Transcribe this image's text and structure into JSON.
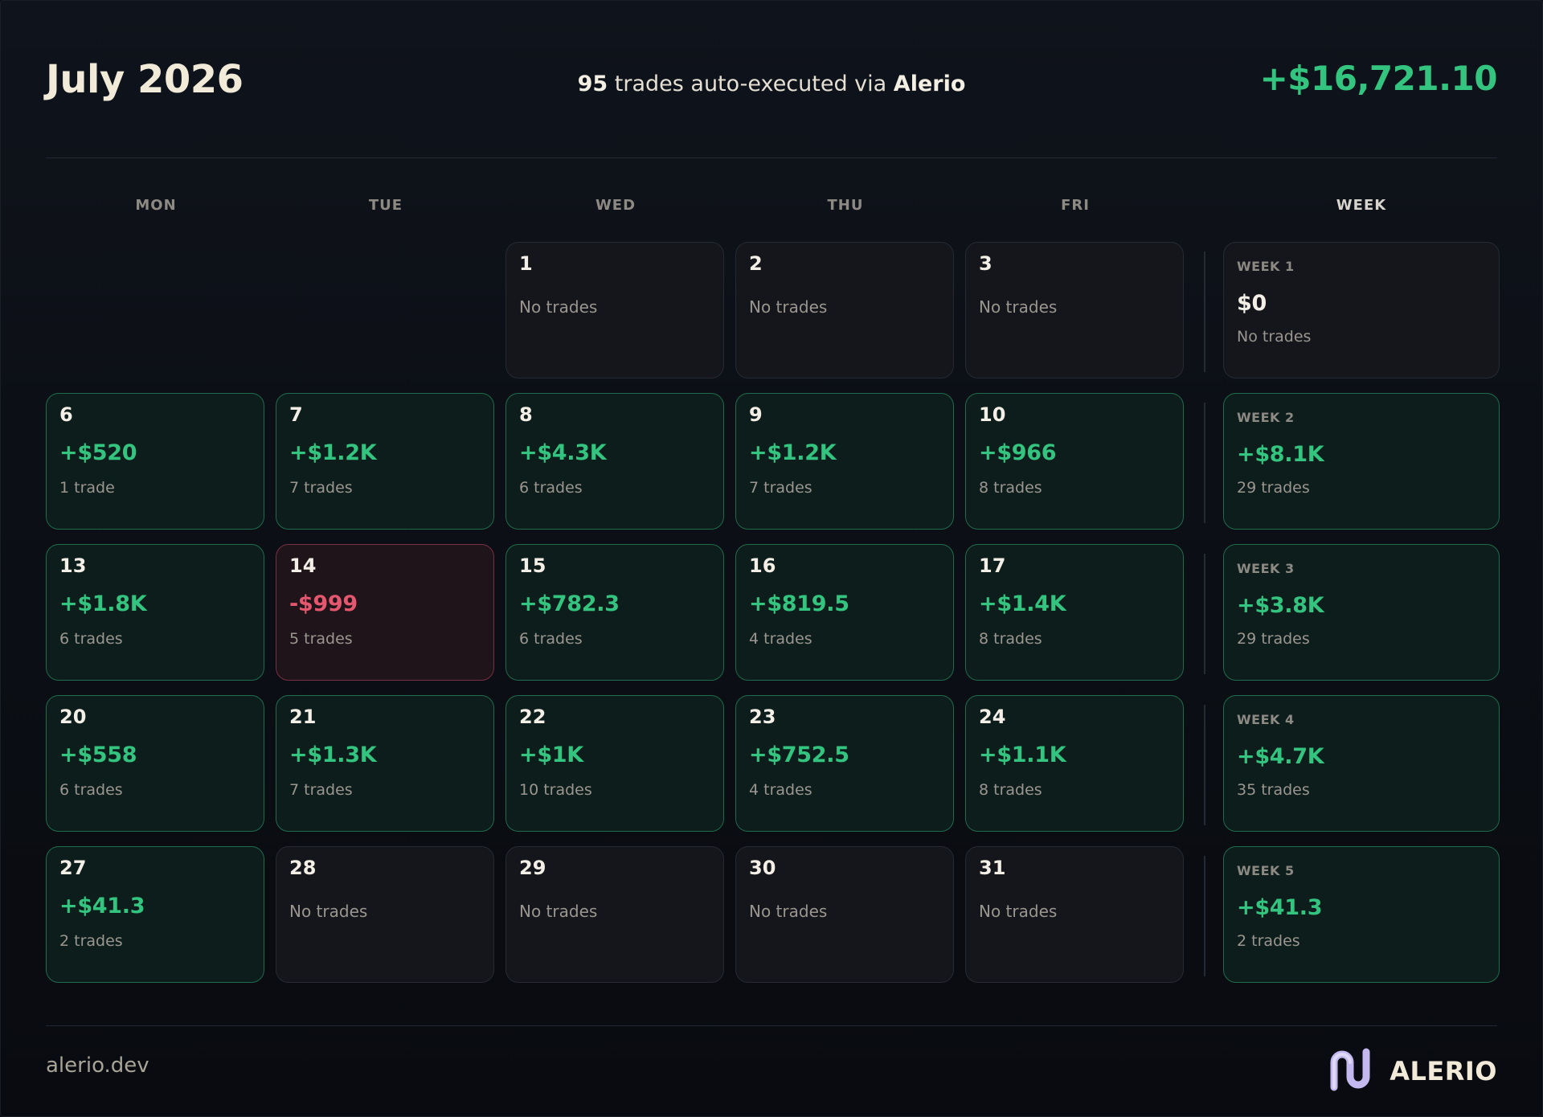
{
  "header": {
    "title": "July 2026",
    "trade_count": "95",
    "subtitle_mid": " trades auto-executed via ",
    "brand_inline": "Alerio",
    "total": "+$16,721.10"
  },
  "weekdays": [
    "MON",
    "TUE",
    "WED",
    "THU",
    "FRI",
    "WEEK"
  ],
  "no_trades_label": "No trades",
  "rows": [
    {
      "days": [
        null,
        null,
        {
          "day": "1"
        },
        {
          "day": "2"
        },
        {
          "day": "3"
        }
      ],
      "week": {
        "label": "WEEK 1",
        "amount": "$0",
        "count": "No trades"
      }
    },
    {
      "days": [
        {
          "day": "6",
          "amount": "+$520",
          "count": "1 trade"
        },
        {
          "day": "7",
          "amount": "+$1.2K",
          "count": "7 trades"
        },
        {
          "day": "8",
          "amount": "+$4.3K",
          "count": "6 trades"
        },
        {
          "day": "9",
          "amount": "+$1.2K",
          "count": "7 trades"
        },
        {
          "day": "10",
          "amount": "+$966",
          "count": "8 trades"
        }
      ],
      "week": {
        "label": "WEEK 2",
        "amount": "+$8.1K",
        "count": "29 trades"
      }
    },
    {
      "days": [
        {
          "day": "13",
          "amount": "+$1.8K",
          "count": "6 trades"
        },
        {
          "day": "14",
          "amount": "-$999",
          "count": "5 trades"
        },
        {
          "day": "15",
          "amount": "+$782.3",
          "count": "6 trades"
        },
        {
          "day": "16",
          "amount": "+$819.5",
          "count": "4 trades"
        },
        {
          "day": "17",
          "amount": "+$1.4K",
          "count": "8 trades"
        }
      ],
      "week": {
        "label": "WEEK 3",
        "amount": "+$3.8K",
        "count": "29 trades"
      }
    },
    {
      "days": [
        {
          "day": "20",
          "amount": "+$558",
          "count": "6 trades"
        },
        {
          "day": "21",
          "amount": "+$1.3K",
          "count": "7 trades"
        },
        {
          "day": "22",
          "amount": "+$1K",
          "count": "10 trades"
        },
        {
          "day": "23",
          "amount": "+$752.5",
          "count": "4 trades"
        },
        {
          "day": "24",
          "amount": "+$1.1K",
          "count": "8 trades"
        }
      ],
      "week": {
        "label": "WEEK 4",
        "amount": "+$4.7K",
        "count": "35 trades"
      }
    },
    {
      "days": [
        {
          "day": "27",
          "amount": "+$41.3",
          "count": "2 trades"
        },
        {
          "day": "28"
        },
        {
          "day": "29"
        },
        {
          "day": "30"
        },
        {
          "day": "31"
        }
      ],
      "week": {
        "label": "WEEK 5",
        "amount": "+$41.3",
        "count": "2 trades"
      }
    }
  ],
  "footer": {
    "domain": "alerio.dev",
    "brand": "ALERIO",
    "logo_icon": "alerio-logo-icon"
  },
  "colors": {
    "positive": "#33c57f",
    "negative": "#e5566f",
    "background": "#0b0e14",
    "logo_lavender": "#c3b9ee"
  }
}
